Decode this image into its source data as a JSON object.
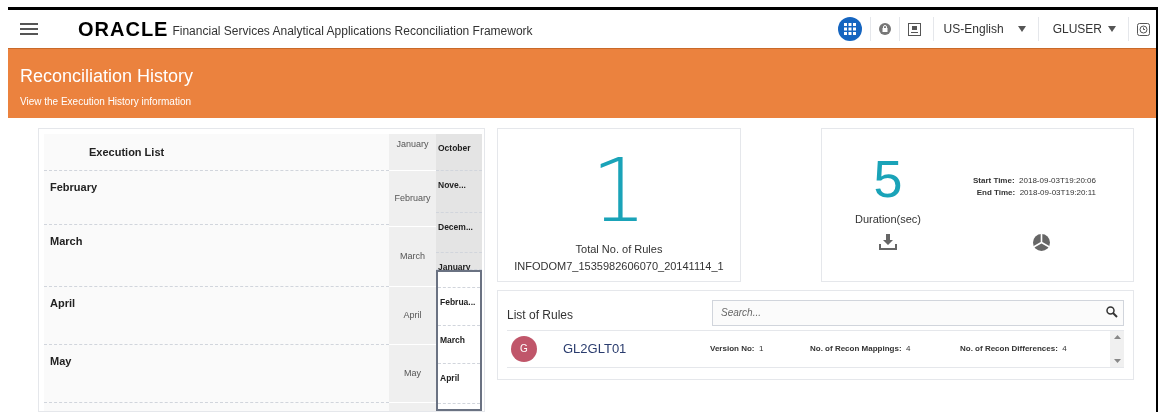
{
  "header": {
    "logo": "ORACLE",
    "app_title": "Financial Services Analytical Applications Reconciliation Framework",
    "language": "US-English",
    "user": "GLUSER"
  },
  "banner": {
    "title": "Reconciliation History",
    "subtitle": "View the Execution History information"
  },
  "execution_list": {
    "title": "Execution List",
    "rows": [
      "February",
      "March",
      "April",
      "May"
    ],
    "month_column": [
      "January",
      "February",
      "March",
      "April",
      "May"
    ],
    "overview": [
      {
        "label": "October",
        "in_view": false
      },
      {
        "label": "Nove...",
        "in_view": false
      },
      {
        "label": "Decem...",
        "in_view": false
      },
      {
        "label": "January",
        "in_view": false
      },
      {
        "in_view": true
      },
      {
        "label": "Februa...",
        "in_view": true
      },
      {
        "label": "March",
        "in_view": true
      },
      {
        "label": "April",
        "in_view": true
      }
    ]
  },
  "rules_card": {
    "count": "1",
    "label": "Total No. of Rules",
    "infodom": "INFODOM7_1535982606070_20141114_1"
  },
  "duration_card": {
    "value": "5",
    "label": "Duration(sec)",
    "start_label": "Start Time:",
    "start_value": "2018-09-03T19:20:06",
    "end_label": "End Time:",
    "end_value": "2018-09-03T19:20:11"
  },
  "list_of_rules": {
    "title": "List of Rules",
    "search": {
      "placeholder": "Search..."
    },
    "rules": [
      {
        "initial": "G",
        "color": "#c0566a",
        "name": "GL2GLT01",
        "version_label": "Version No:",
        "version": "1",
        "mappings_label": "No. of Recon Mappings:",
        "mappings": "4",
        "differences_label": "No. of Recon Differences:",
        "differences": "4"
      }
    ]
  }
}
